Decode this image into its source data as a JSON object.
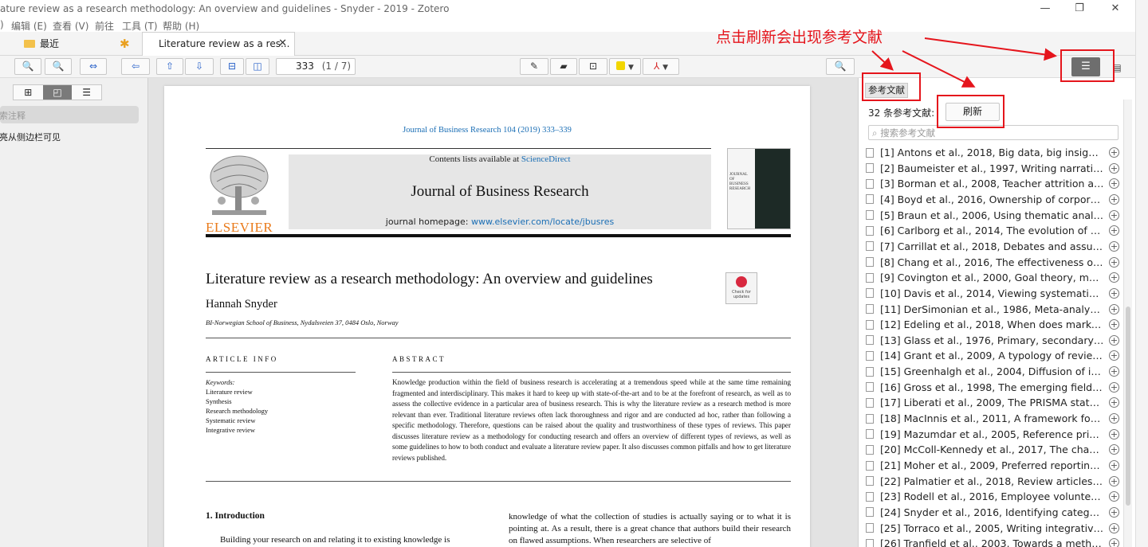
{
  "window": {
    "title": "ature review as a research methodology: An overview and guidelines - Snyder - 2019 - Zotero"
  },
  "menu": {
    "items": [
      ")",
      "编辑 (E)",
      "查看 (V)",
      "前往",
      "工具 (T)",
      "帮助 (H)"
    ]
  },
  "tabs": {
    "recent_label": "最近",
    "active_label": "Literature review as a res...",
    "close": "✕"
  },
  "toolbar": {
    "page_input": "333",
    "page_count": "(1 / 7)"
  },
  "sidebar": {
    "search_placeholder": "搜索注释",
    "hint": "高亮从侧边栏可见"
  },
  "paper": {
    "journal_line": "Journal of Business Research 104 (2019) 333–339",
    "contents_prefix": "Contents lists available at ",
    "contents_link": "ScienceDirect",
    "journal_name": "Journal of Business Research",
    "homepage_prefix": "journal homepage: ",
    "homepage_link": "www.elsevier.com/locate/jbusres",
    "publisher": "ELSEVIER",
    "cover_text": "JOURNAL OF BUSINESS RESEARCH",
    "title": "Literature review as a research methodology: An overview and guidelines",
    "author": "Hannah Snyder",
    "affiliation": "BI-Norwegian School of Business, Nydalsveien 37, 0484 Oslo, Norway",
    "check_updates": "Check for updates",
    "article_info_heading": "ARTICLE INFO",
    "abstract_heading": "ABSTRACT",
    "keywords_label": "Keywords:",
    "keywords": [
      "Literature review",
      "Synthesis",
      "Research methodology",
      "Systematic review",
      "Integrative review"
    ],
    "abstract_text": "Knowledge production within the field of business research is accelerating at a tremendous speed while at the same time remaining fragmented and interdisciplinary. This makes it hard to keep up with state-of-the-art and to be at the forefront of research, as well as to assess the collective evidence in a particular area of business research. This is why the literature review as a research method is more relevant than ever. Traditional literature reviews often lack thoroughness and rigor and are conducted ad hoc, rather than following a specific methodology. Therefore, questions can be raised about the quality and trustworthiness of these types of reviews. This paper discusses literature review as a methodology for conducting research and offers an overview of different types of reviews, as well as some guidelines to how to both conduct and evaluate a literature review paper. It also discusses common pitfalls and how to get literature reviews published.",
    "intro_heading": "1.  Introduction",
    "intro_left": "Building your research on and relating it to existing knowledge is",
    "intro_right": "knowledge of what the collection of studies is actually saying or to what it is pointing at. As a result, there is a great chance that authors build their research on flawed assumptions. When researchers are selective of"
  },
  "refs_pane": {
    "tab_label": "参考文献",
    "count_label": "32 条参考文献:",
    "refresh_label": "刷新",
    "search_placeholder": "搜索参考文献",
    "items": [
      "[1] Antons et al., 2018, Big data, big insights? Ad...",
      "[2] Baumeister et al., 1997, Writing narrative liter...",
      "[3] Borman et al., 2008, Teacher attrition and ret...",
      "[4] Boyd et al., 2016, Ownership of corporations:...",
      "[5] Braun et al., 2006, Using thematic analysis in ...",
      "[6] Carlborg et al., 2014, The evolution of service...",
      "[7] Carrillat et al., 2018, Debates and assumption...",
      "[8] Chang et al., 2016, The effectiveness of custo...",
      "[9] Covington et al., 2000, Goal theory, motivatio...",
      "[10] Davis et al., 2014, Viewing systematic review...",
      "[11] DerSimonian et al., 1986, Meta-analysis in cl...",
      "[12] Edeling et al., 2018, When does market shar...",
      "[13] Glass et al., 1976, Primary, secondary, and m...",
      "[14] Grant et al., 2009, A typology of reviews: An...",
      "[15] Greenhalgh et al., 2004, Diffusion of innovat...",
      "[16] Gross et al., 1998, The emerging field of em...",
      "[17] Liberati et al., 2009, The PRISMA statement ...",
      "[18] MacInnis et al., 2011, A framework for conc...",
      "[19] Mazumdar et al., 2005, Reference price rese...",
      "[20] McColl-Kennedy et al., 2017, The changing r...",
      "[21] Moher et al., 2009, Preferred reporting item...",
      "[22] Palmatier et al., 2018, Review articles: Purpo...",
      "[23] Rodell et al., 2016, Employee volunteering: ...",
      "[24] Snyder et al., 2016, Identifying categories of...",
      "[25] Torraco et al., 2005, Writing integrative liter...",
      "[26] Tranfield et al., 2003, Towards a methodolo..."
    ]
  },
  "annotation": {
    "text": "点击刷新会出现参考文献",
    "color": "#e5151c"
  },
  "colors": {
    "accent": "#2a62c9",
    "highlight_yellow": "#f2d600",
    "link": "#1a6eb5"
  }
}
